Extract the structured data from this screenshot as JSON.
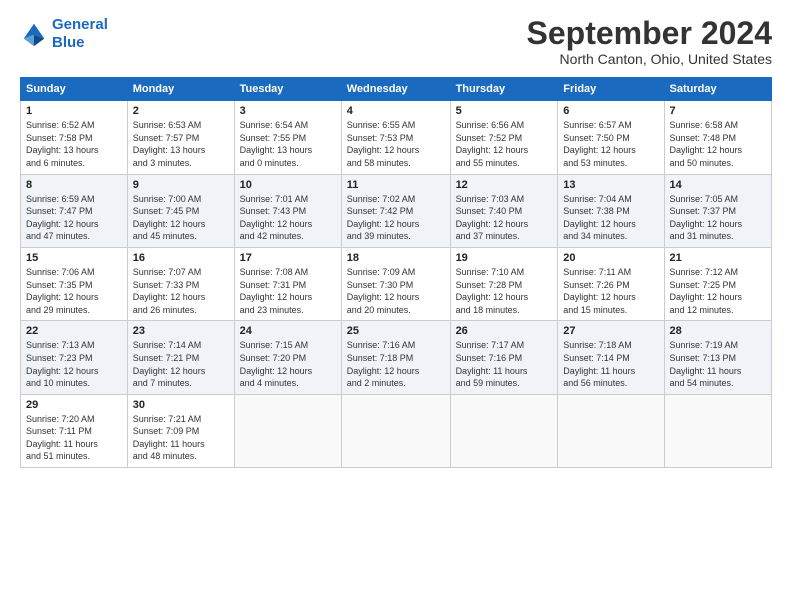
{
  "header": {
    "logo_line1": "General",
    "logo_line2": "Blue",
    "month": "September 2024",
    "location": "North Canton, Ohio, United States"
  },
  "weekdays": [
    "Sunday",
    "Monday",
    "Tuesday",
    "Wednesday",
    "Thursday",
    "Friday",
    "Saturday"
  ],
  "weeks": [
    [
      {
        "day": "1",
        "info": "Sunrise: 6:52 AM\nSunset: 7:58 PM\nDaylight: 13 hours\nand 6 minutes."
      },
      {
        "day": "2",
        "info": "Sunrise: 6:53 AM\nSunset: 7:57 PM\nDaylight: 13 hours\nand 3 minutes."
      },
      {
        "day": "3",
        "info": "Sunrise: 6:54 AM\nSunset: 7:55 PM\nDaylight: 13 hours\nand 0 minutes."
      },
      {
        "day": "4",
        "info": "Sunrise: 6:55 AM\nSunset: 7:53 PM\nDaylight: 12 hours\nand 58 minutes."
      },
      {
        "day": "5",
        "info": "Sunrise: 6:56 AM\nSunset: 7:52 PM\nDaylight: 12 hours\nand 55 minutes."
      },
      {
        "day": "6",
        "info": "Sunrise: 6:57 AM\nSunset: 7:50 PM\nDaylight: 12 hours\nand 53 minutes."
      },
      {
        "day": "7",
        "info": "Sunrise: 6:58 AM\nSunset: 7:48 PM\nDaylight: 12 hours\nand 50 minutes."
      }
    ],
    [
      {
        "day": "8",
        "info": "Sunrise: 6:59 AM\nSunset: 7:47 PM\nDaylight: 12 hours\nand 47 minutes."
      },
      {
        "day": "9",
        "info": "Sunrise: 7:00 AM\nSunset: 7:45 PM\nDaylight: 12 hours\nand 45 minutes."
      },
      {
        "day": "10",
        "info": "Sunrise: 7:01 AM\nSunset: 7:43 PM\nDaylight: 12 hours\nand 42 minutes."
      },
      {
        "day": "11",
        "info": "Sunrise: 7:02 AM\nSunset: 7:42 PM\nDaylight: 12 hours\nand 39 minutes."
      },
      {
        "day": "12",
        "info": "Sunrise: 7:03 AM\nSunset: 7:40 PM\nDaylight: 12 hours\nand 37 minutes."
      },
      {
        "day": "13",
        "info": "Sunrise: 7:04 AM\nSunset: 7:38 PM\nDaylight: 12 hours\nand 34 minutes."
      },
      {
        "day": "14",
        "info": "Sunrise: 7:05 AM\nSunset: 7:37 PM\nDaylight: 12 hours\nand 31 minutes."
      }
    ],
    [
      {
        "day": "15",
        "info": "Sunrise: 7:06 AM\nSunset: 7:35 PM\nDaylight: 12 hours\nand 29 minutes."
      },
      {
        "day": "16",
        "info": "Sunrise: 7:07 AM\nSunset: 7:33 PM\nDaylight: 12 hours\nand 26 minutes."
      },
      {
        "day": "17",
        "info": "Sunrise: 7:08 AM\nSunset: 7:31 PM\nDaylight: 12 hours\nand 23 minutes."
      },
      {
        "day": "18",
        "info": "Sunrise: 7:09 AM\nSunset: 7:30 PM\nDaylight: 12 hours\nand 20 minutes."
      },
      {
        "day": "19",
        "info": "Sunrise: 7:10 AM\nSunset: 7:28 PM\nDaylight: 12 hours\nand 18 minutes."
      },
      {
        "day": "20",
        "info": "Sunrise: 7:11 AM\nSunset: 7:26 PM\nDaylight: 12 hours\nand 15 minutes."
      },
      {
        "day": "21",
        "info": "Sunrise: 7:12 AM\nSunset: 7:25 PM\nDaylight: 12 hours\nand 12 minutes."
      }
    ],
    [
      {
        "day": "22",
        "info": "Sunrise: 7:13 AM\nSunset: 7:23 PM\nDaylight: 12 hours\nand 10 minutes."
      },
      {
        "day": "23",
        "info": "Sunrise: 7:14 AM\nSunset: 7:21 PM\nDaylight: 12 hours\nand 7 minutes."
      },
      {
        "day": "24",
        "info": "Sunrise: 7:15 AM\nSunset: 7:20 PM\nDaylight: 12 hours\nand 4 minutes."
      },
      {
        "day": "25",
        "info": "Sunrise: 7:16 AM\nSunset: 7:18 PM\nDaylight: 12 hours\nand 2 minutes."
      },
      {
        "day": "26",
        "info": "Sunrise: 7:17 AM\nSunset: 7:16 PM\nDaylight: 11 hours\nand 59 minutes."
      },
      {
        "day": "27",
        "info": "Sunrise: 7:18 AM\nSunset: 7:14 PM\nDaylight: 11 hours\nand 56 minutes."
      },
      {
        "day": "28",
        "info": "Sunrise: 7:19 AM\nSunset: 7:13 PM\nDaylight: 11 hours\nand 54 minutes."
      }
    ],
    [
      {
        "day": "29",
        "info": "Sunrise: 7:20 AM\nSunset: 7:11 PM\nDaylight: 11 hours\nand 51 minutes."
      },
      {
        "day": "30",
        "info": "Sunrise: 7:21 AM\nSunset: 7:09 PM\nDaylight: 11 hours\nand 48 minutes."
      },
      null,
      null,
      null,
      null,
      null
    ]
  ]
}
